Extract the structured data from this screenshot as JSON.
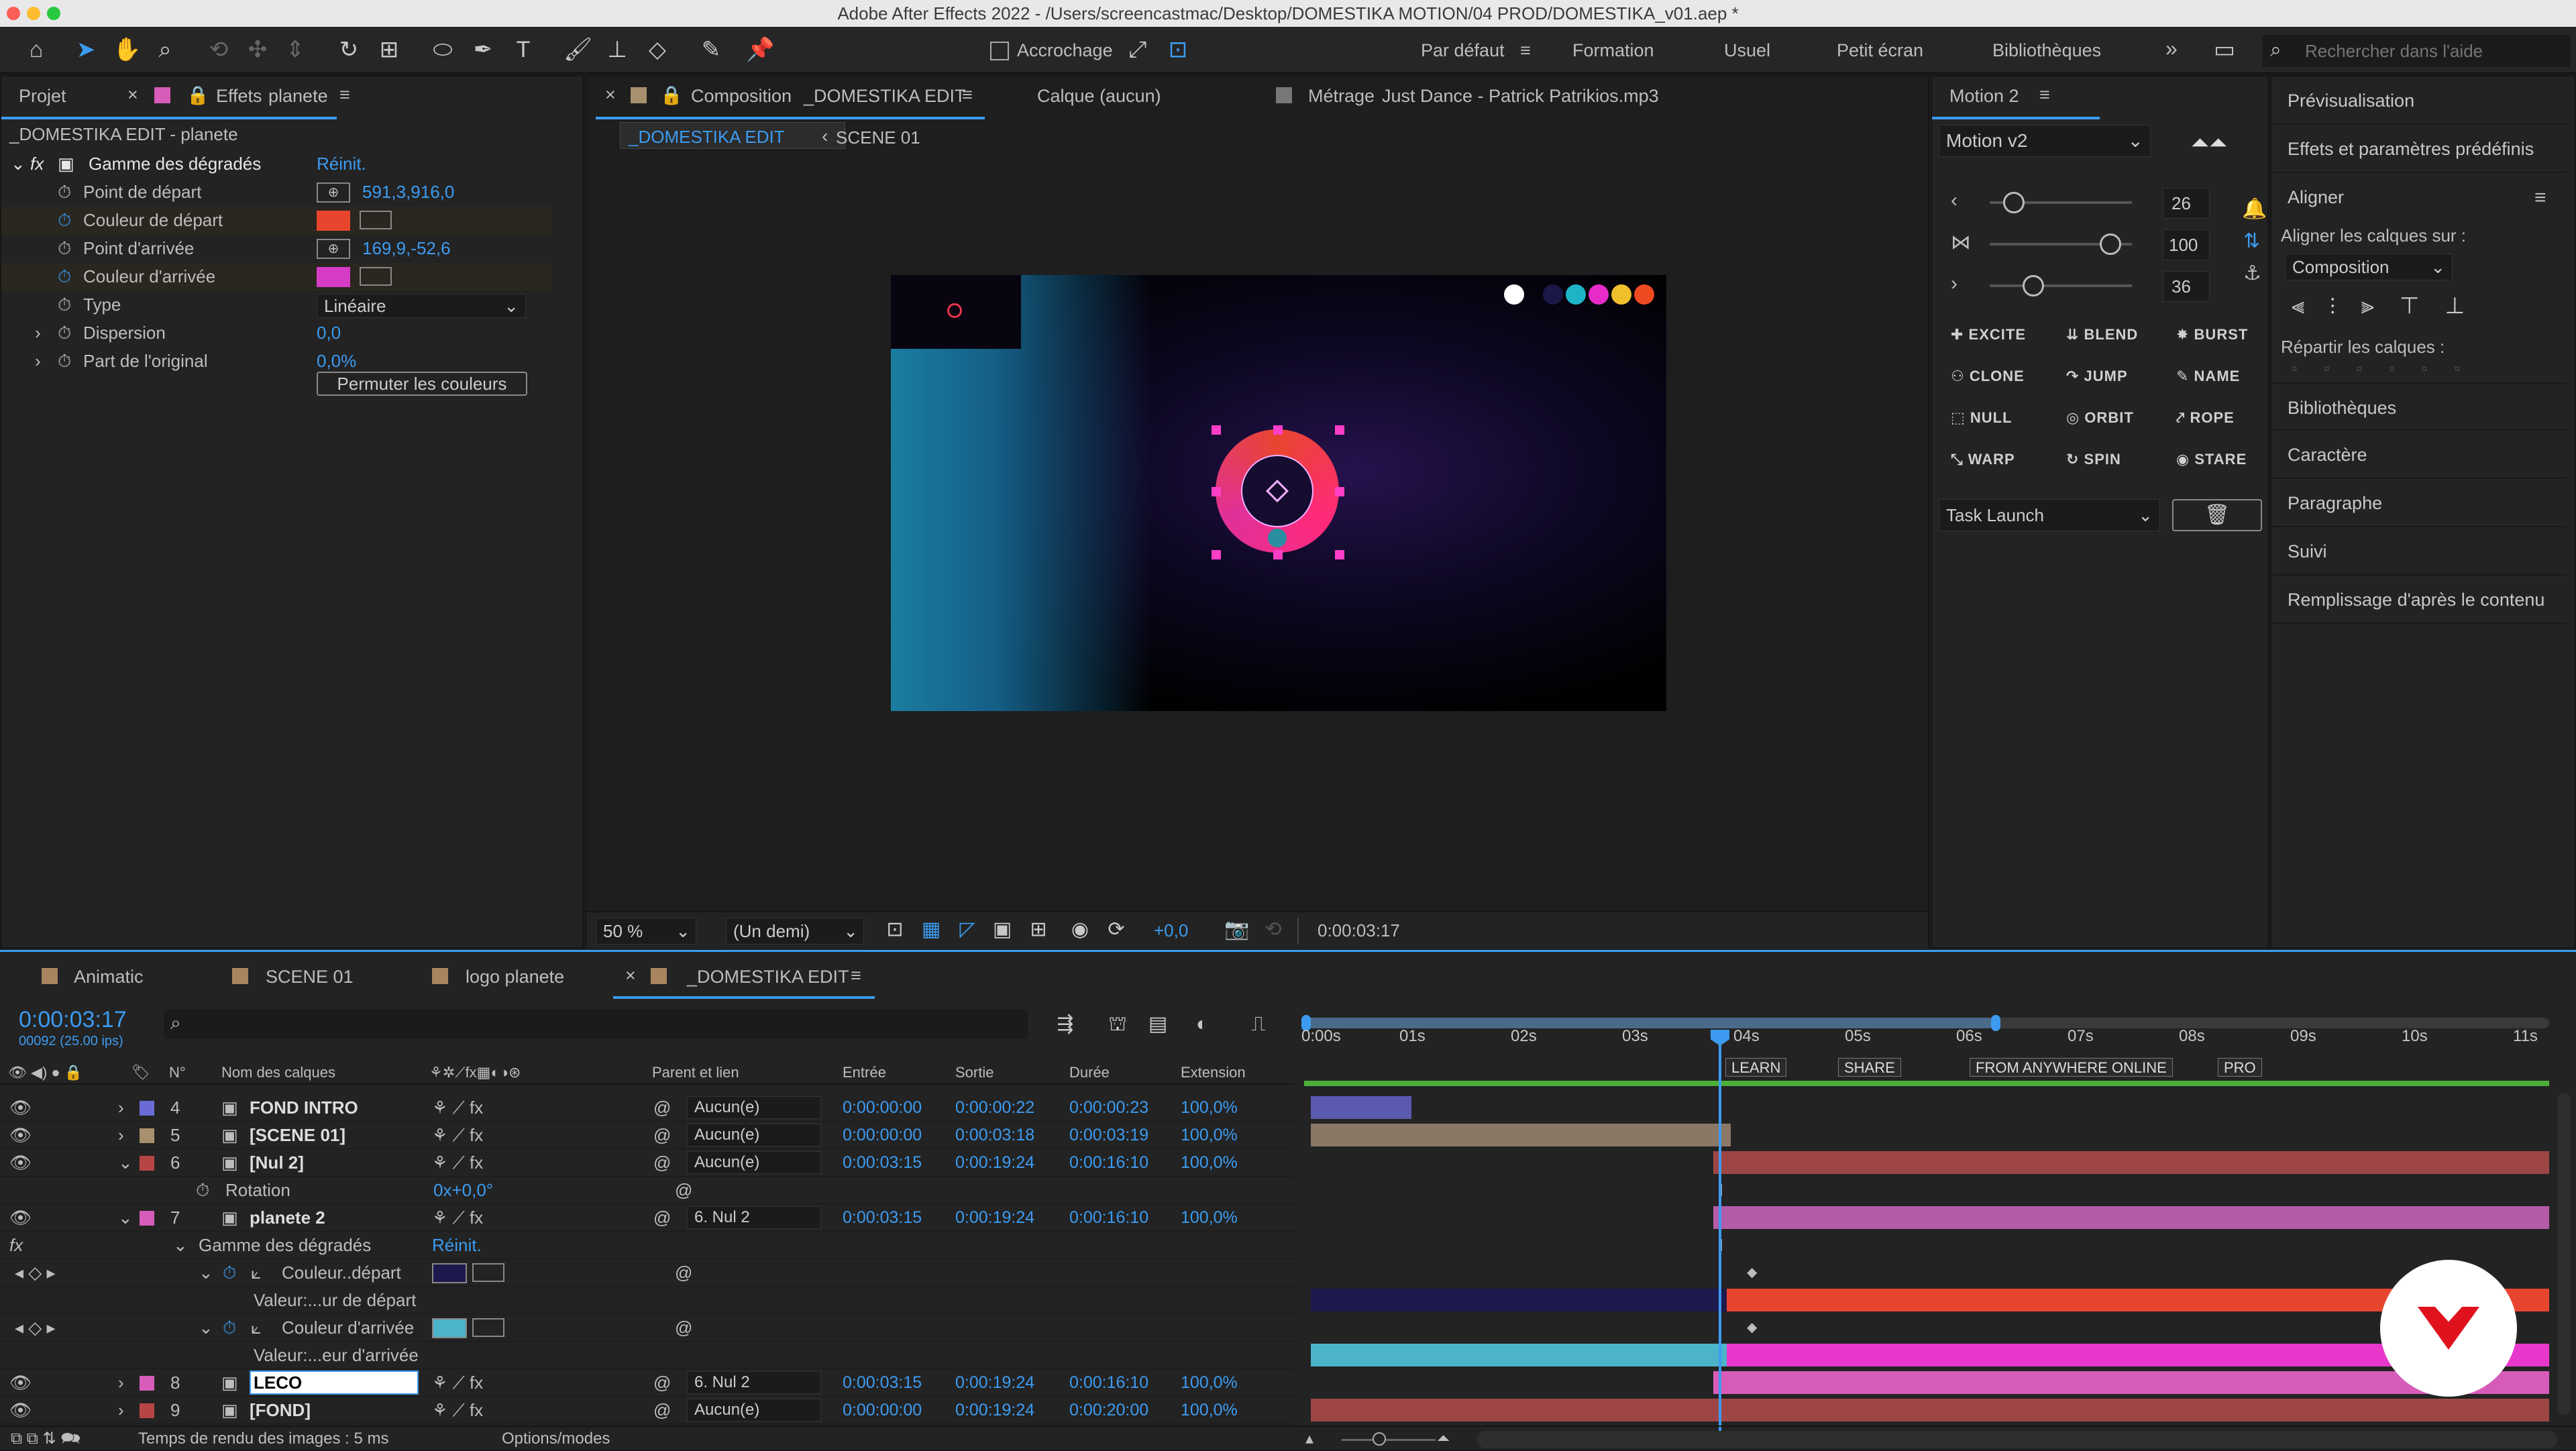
{
  "window": {
    "title": "Adobe After Effects 2022 - /Users/screencastmac/Desktop/DOMESTIKA MOTION/04 PROD/DOMESTIKA_v01.aep *"
  },
  "toolbar": {
    "snap_label": "Accrochage",
    "workspaces": [
      "Par défaut",
      "Formation",
      "Usuel",
      "Petit écran",
      "Bibliothèques"
    ],
    "help_search_placeholder": "Rechercher dans l'aide"
  },
  "effects_panel": {
    "tab_project": "Projet",
    "tab_effects": "Effets",
    "tab_effects_layer": "planete",
    "layer_path": "_DOMESTIKA EDIT - planete",
    "effect_name": "Gamme des dégradés",
    "reset_label": "Réinit.",
    "props": [
      {
        "label": "Point de départ",
        "value": "591,3,916,0"
      },
      {
        "label": "Couleur de départ",
        "color": "#e8452f"
      },
      {
        "label": "Point d'arrivée",
        "value": "169,9,-52,6"
      },
      {
        "label": "Couleur d'arrivée",
        "color": "#d63cc6"
      },
      {
        "label": "Type",
        "value": "Linéaire"
      },
      {
        "label": "Dispersion",
        "value": "0,0"
      },
      {
        "label": "Part de l'original",
        "value": "0,0%"
      }
    ],
    "swap_button": "Permuter les couleurs"
  },
  "comp_panel": {
    "tab_label": "Composition",
    "comp_name": "_DOMESTIKA EDIT",
    "layer_tab": "Calque (aucun)",
    "footage_tab": "Métrage",
    "footage_name": "Just Dance - Patrick Patrikios.mp3",
    "breadcrumb": [
      "_DOMESTIKA EDIT",
      "SCENE 01"
    ],
    "zoom": "50 %",
    "resolution": "(Un demi)",
    "exposure": "+0,0",
    "timecode": "0:00:03:17",
    "palette": [
      "#ffffff",
      "#1b1747",
      "#1fb3c8",
      "#e62bc8",
      "#f0c02c",
      "#f04a23"
    ]
  },
  "motion_panel": {
    "title": "Motion 2",
    "preset": "Motion v2",
    "sliders": [
      {
        "value": "26",
        "level": 0.2
      },
      {
        "value": "100",
        "level": 1.0
      },
      {
        "value": "36",
        "level": 0.36
      }
    ],
    "buttons": [
      [
        "EXCITE",
        "BLEND",
        "BURST"
      ],
      [
        "CLONE",
        "JUMP",
        "NAME"
      ],
      [
        "NULL",
        "ORBIT",
        "ROPE"
      ],
      [
        "WARP",
        "SPIN",
        "STARE"
      ]
    ],
    "task": "Task Launch"
  },
  "right_panel": {
    "items_top": [
      "Prévisualisation",
      "Effets et paramètres prédéfinis"
    ],
    "align_title": "Aligner",
    "align_to_label": "Aligner les calques sur :",
    "align_to_value": "Composition",
    "distribute_label": "Répartir les calques :",
    "items_bottom": [
      "Bibliothèques",
      "Caractère",
      "Paragraphe",
      "Suivi",
      "Remplissage d'après le contenu"
    ]
  },
  "timeline": {
    "tabs": [
      "Animatic",
      "SCENE 01",
      "logo planete",
      "_DOMESTIKA EDIT"
    ],
    "tab_colors": [
      "#a8855f",
      "#a8855f",
      "#a8855f",
      "#a8855f"
    ],
    "current_time": "0:00:03:17",
    "frame_info": "00092 (25.00 ips)",
    "columns": {
      "num": "N°",
      "name": "Nom des calques",
      "parent": "Parent et lien",
      "in": "Entrée",
      "out": "Sortie",
      "dur": "Durée",
      "stretch": "Extension"
    },
    "ruler": [
      "0:00s",
      "01s",
      "02s",
      "03s",
      "04s",
      "05s",
      "06s",
      "07s",
      "08s",
      "09s",
      "10s",
      "11s"
    ],
    "markers": [
      "LEARN",
      "SHARE",
      "FROM ANYWHERE ONLINE",
      "PRO"
    ],
    "layers": [
      {
        "num": "4",
        "color": "#6b6bd6",
        "name": "FOND INTRO",
        "parent": "Aucun(e)",
        "in": "0:00:00:00",
        "out": "0:00:00:22",
        "dur": "0:00:00:23",
        "stretch": "100,0%"
      },
      {
        "num": "5",
        "color": "#a8906e",
        "name": "[SCENE 01]",
        "parent": "Aucun(e)",
        "in": "0:00:00:00",
        "out": "0:00:03:18",
        "dur": "0:00:03:19",
        "stretch": "100,0%"
      },
      {
        "num": "6",
        "color": "#b84545",
        "name": "[Nul 2]",
        "parent": "Aucun(e)",
        "in": "0:00:03:15",
        "out": "0:00:19:24",
        "dur": "0:00:16:10",
        "stretch": "100,0%"
      },
      {
        "num": "7",
        "color": "#d65cb8",
        "name": "planete 2",
        "parent": "6. Nul 2",
        "in": "0:00:03:15",
        "out": "0:00:19:24",
        "dur": "0:00:16:10",
        "stretch": "100,0%"
      },
      {
        "num": "8",
        "color": "#d65cb8",
        "name": "LECO",
        "parent": "6. Nul 2",
        "in": "0:00:03:15",
        "out": "0:00:19:24",
        "dur": "0:00:16:10",
        "stretch": "100,0%"
      },
      {
        "num": "9",
        "color": "#b84545",
        "name": "[FOND]",
        "parent": "Aucun(e)",
        "in": "0:00:00:00",
        "out": "0:00:19:24",
        "dur": "0:00:20:00",
        "stretch": "100,0%"
      }
    ],
    "rotation_label": "Rotation",
    "rotation_value": "0x+0,0°",
    "effect_group": "Gamme des dégradés",
    "effect_reset": "Réinit.",
    "prop_start": "Couleur..départ",
    "prop_start_sub": "Valeur:...ur de départ",
    "prop_end": "Couleur d'arrivée",
    "prop_end_sub": "Valeur:...eur d'arrivée",
    "status_render": "Temps de rendu des images : 5 ms",
    "status_options": "Options/modes"
  }
}
